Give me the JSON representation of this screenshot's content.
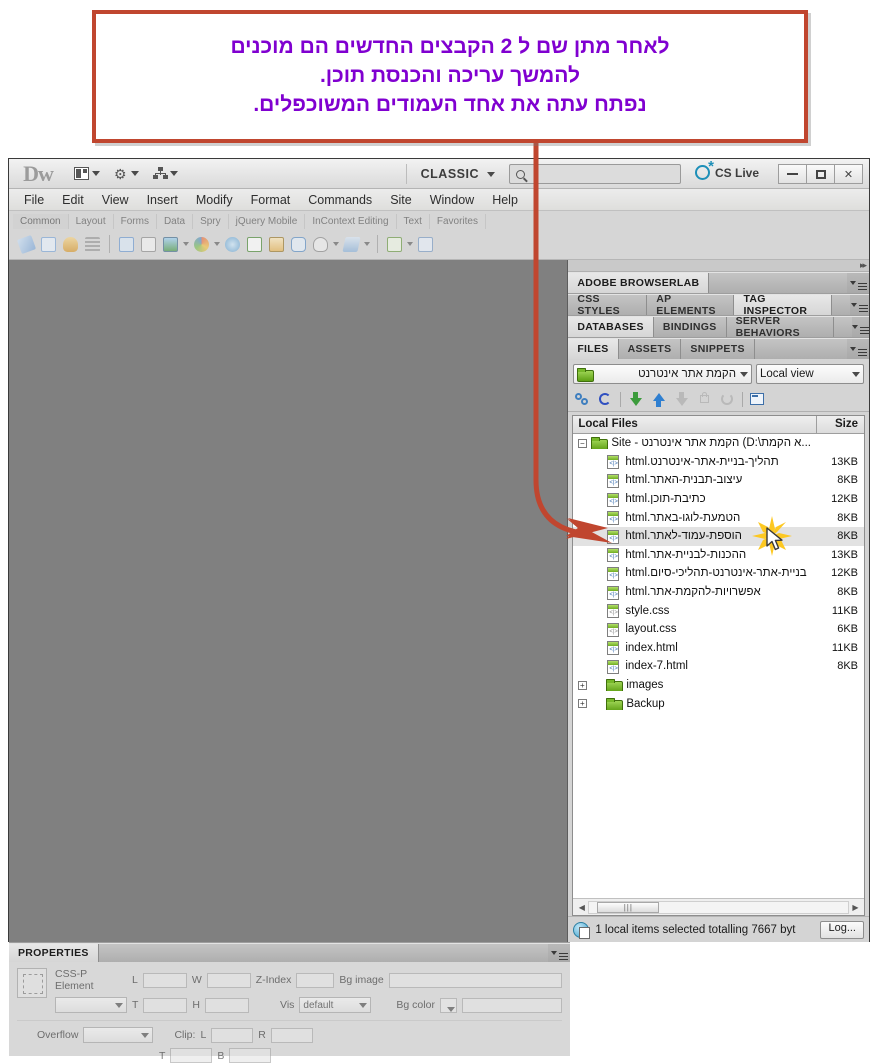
{
  "callout": {
    "text": "לאחר מתן שם ל 2 הקבצים החדשים הם מוכנים\nלהמשך עריכה והכנסת תוכן.\nנפתח עתה את אחד העמודים המשוכפלים.",
    "border_color": "#c0462f",
    "text_color": "#8000d0"
  },
  "titlebar": {
    "logo": "Dw",
    "workspace": "CLASSIC",
    "search_value": "",
    "search_placeholder": "",
    "cs_live": "CS Live",
    "minimize": "—",
    "restore": "□",
    "close": "✕"
  },
  "menubar": {
    "items": [
      "File",
      "Edit",
      "View",
      "Insert",
      "Modify",
      "Format",
      "Commands",
      "Site",
      "Window",
      "Help"
    ]
  },
  "insertbar": {
    "tabs": [
      "Common",
      "Layout",
      "Forms",
      "Data",
      "Spry",
      "jQuery Mobile",
      "InContext Editing",
      "Text",
      "Favorites"
    ],
    "active_tab": "Common"
  },
  "panels": {
    "groups": [
      {
        "tabs": [
          "ADOBE BROWSERLAB"
        ],
        "active": "ADOBE BROWSERLAB"
      },
      {
        "tabs": [
          "CSS STYLES",
          "AP ELEMENTS",
          "TAG INSPECTOR"
        ],
        "active": "TAG INSPECTOR"
      },
      {
        "tabs": [
          "DATABASES",
          "BINDINGS",
          "SERVER BEHAVIORS"
        ],
        "active": "DATABASES"
      },
      {
        "tabs": [
          "FILES",
          "ASSETS",
          "SNIPPETS"
        ],
        "active": "FILES"
      }
    ]
  },
  "files_panel": {
    "site_selector": "הקמת אתר אינטרנט",
    "view_selector": "Local view",
    "columns": {
      "name": "Local Files",
      "size": "Size"
    },
    "root": "Site - הקמת אתר אינטרנט (D:\\א הקמת...",
    "rows": [
      {
        "name": "תהליך-בניית-אתר-אינטרנט.html",
        "size": "13KB",
        "type": "html",
        "selected": false
      },
      {
        "name": "עיצוב-תבנית-האתר.html",
        "size": "8KB",
        "type": "html",
        "selected": false
      },
      {
        "name": "כתיבת-תוכן.html",
        "size": "12KB",
        "type": "html",
        "selected": false
      },
      {
        "name": "הטמעת-לוגו-באתר.html",
        "size": "8KB",
        "type": "html",
        "selected": false
      },
      {
        "name": "הוספת-עמוד-לאתר.html",
        "size": "8KB",
        "type": "html",
        "selected": true
      },
      {
        "name": "ההכנות-לבניית-אתר.html",
        "size": "13KB",
        "type": "html",
        "selected": false
      },
      {
        "name": "בניית-אתר-אינטרנט-תהליכי-סיום.html",
        "size": "12KB",
        "type": "html",
        "selected": false
      },
      {
        "name": "אפשרויות-להקמת-אתר.html",
        "size": "8KB",
        "type": "html",
        "selected": false
      },
      {
        "name": "style.css",
        "size": "11KB",
        "type": "css",
        "selected": false
      },
      {
        "name": "layout.css",
        "size": "6KB",
        "type": "css",
        "selected": false
      },
      {
        "name": "index.html",
        "size": "11KB",
        "type": "html",
        "selected": false
      },
      {
        "name": "index-7.html",
        "size": "8KB",
        "type": "html",
        "selected": false
      },
      {
        "name": "images",
        "size": "",
        "type": "folder",
        "selected": false
      },
      {
        "name": "Backup",
        "size": "",
        "type": "folder",
        "selected": false
      }
    ],
    "status": "1 local items selected totalling 7667 byt",
    "log_button": "Log..."
  },
  "properties": {
    "tab": "PROPERTIES",
    "element_label": "CSS-P Element",
    "element_value": "",
    "l_label": "L",
    "l_value": "",
    "w_label": "W",
    "w_value": "",
    "z_label": "Z-Index",
    "z_value": "",
    "bgimage_label": "Bg image",
    "bgimage_value": "",
    "t_label": "T",
    "t_value": "",
    "h_label": "H",
    "h_value": "",
    "vis_label": "Vis",
    "vis_value": "default",
    "bgcolor_label": "Bg color",
    "bgcolor_value": "",
    "overflow_label": "Overflow",
    "overflow_value": "",
    "clip_label": "Clip:",
    "clip_l_label": "L",
    "clip_l_value": "",
    "clip_r_label": "R",
    "clip_r_value": "",
    "clip_t_label": "T",
    "clip_t_value": "",
    "clip_b_label": "B",
    "clip_b_value": ""
  }
}
